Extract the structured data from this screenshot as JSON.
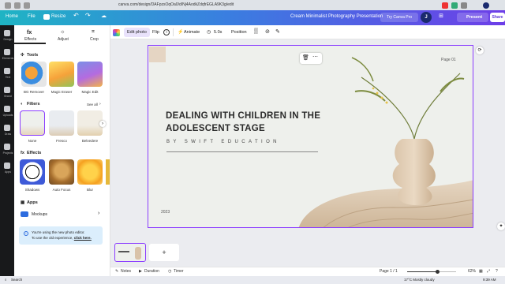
{
  "browser": {
    "url": "canva.com/design/DAFpzsOqOa0/d/Nj4AodkZdqfrEGLA9K3g/edit"
  },
  "header": {
    "home": "Home",
    "file": "File",
    "resize": "Resize",
    "doc_title": "Cream Minimalist Photography Presentation",
    "try_pro": "Try Canva Pro",
    "avatar": "J",
    "present": "Present",
    "share": "Share"
  },
  "rail": {
    "items": [
      "Design",
      "Elements",
      "Text",
      "Brand",
      "Uploads",
      "Draw",
      "Projects",
      "Apps"
    ]
  },
  "panel": {
    "tabs": [
      "Effects",
      "Adjust",
      "Crop"
    ],
    "tools_title": "Tools",
    "tools": [
      "BG Remover",
      "Magic Eraser",
      "Magic Edit"
    ],
    "filters_title": "Filters",
    "see_all": "See all",
    "filters": [
      "None",
      "Fresco",
      "Belvedere"
    ],
    "effects_title": "Effects",
    "effects": [
      "Shadows",
      "Auto Focus",
      "Blur"
    ],
    "apps_title": "Apps",
    "mockups": "Mockups",
    "notice_text": "You're using the new photo editor.",
    "notice_link_prefix": "To use the old experience, ",
    "notice_link": "click here."
  },
  "toolbar": {
    "edit_photo": "Edit photo",
    "flip": "Flip",
    "animate": "Animate",
    "duration": "5.0s",
    "position": "Position"
  },
  "slide": {
    "title": "DEALING WITH CHILDREN IN THE ADOLESCENT STAGE",
    "subtitle": "BY SWIFT EDUCATION",
    "year": "2023",
    "page_label": "Page 01"
  },
  "bottom": {
    "notes": "Notes",
    "duration": "Duration",
    "timer": "Timer",
    "page_count": "Page 1 / 1",
    "zoom": "62%",
    "zoom_fraction": 0.62
  },
  "taskbar": {
    "search": "Search",
    "weather": "17°C  Mostly cloudy",
    "time": "9:39 AM"
  },
  "colors": {
    "accent": "#8b3dff",
    "rail_bg": "#18191b",
    "canvas_bg": "#ebecf0"
  }
}
